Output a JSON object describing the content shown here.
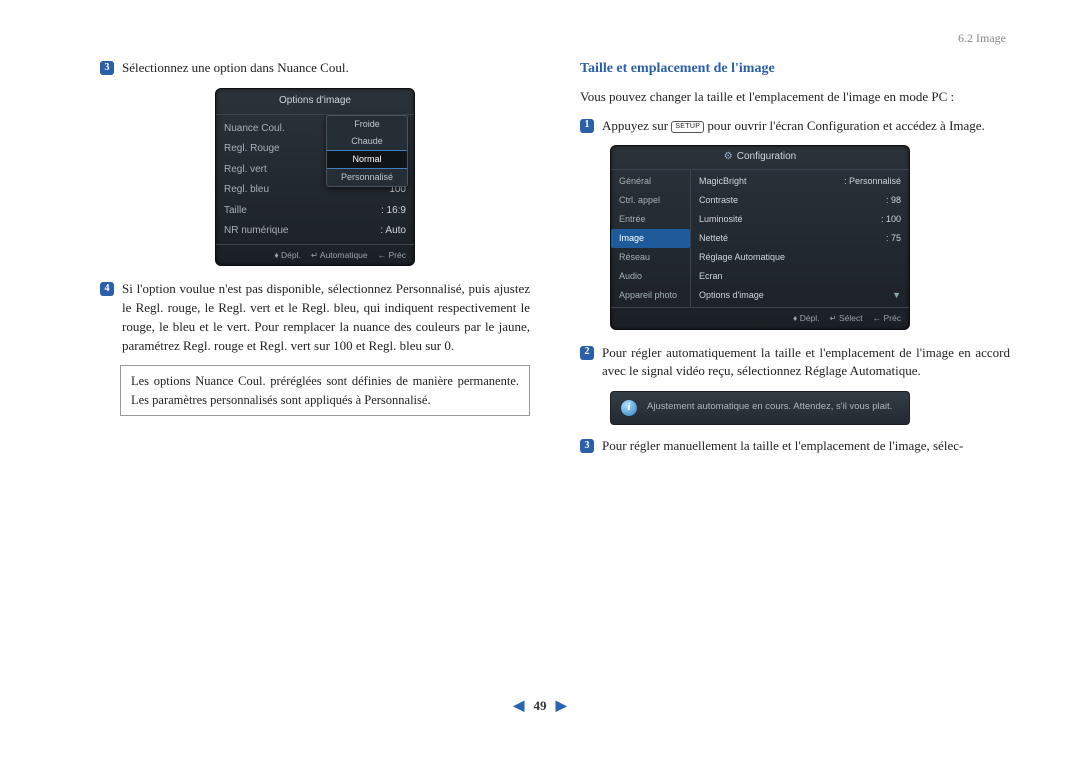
{
  "header": {
    "section": "6.2 Image"
  },
  "left": {
    "step3": {
      "num": "3",
      "text": "Sélectionnez une option dans Nuance Coul."
    },
    "osd1": {
      "title": "Options d'image",
      "rows": {
        "nuance": "Nuance Coul.",
        "regl_rouge": "Regl. Rouge",
        "regl_vert": "Regl. vert",
        "regl_bleu_label": "Regl. bleu",
        "regl_bleu_val": "100",
        "taille_label": "Taille",
        "taille_val": ": 16:9",
        "nr_label": "NR numérique",
        "nr_val": ": Auto"
      },
      "dropdown": {
        "opt1": "Froide",
        "opt2": "Chaude",
        "opt3": "Normal",
        "opt4": "Personnalisé"
      },
      "footer": {
        "move": "Dépl.",
        "auto": "Automatique",
        "back": "Préc"
      }
    },
    "step4": {
      "num": "4",
      "text": "Si l'option voulue n'est pas disponible, sélectionnez Personnalisé, puis ajustez le Regl. rouge, le Regl. vert et le Regl. bleu, qui indiquent respectivement le rouge, le bleu et le vert. Pour remplacer la nuance des couleurs par le jaune, paramétrez Regl. rouge et Regl. vert sur 100 et Regl. bleu sur 0."
    },
    "note": "Les options Nuance Coul. préréglées sont définies de manière permanente. Les paramètres personnalisés sont appliqués à Personnalisé."
  },
  "right": {
    "title": "Taille et emplacement de l'image",
    "intro": "Vous pouvez changer la taille et l'emplacement de l'image en mode PC :",
    "step1": {
      "num": "1",
      "pre": "Appuyez sur ",
      "key": "SETUP",
      "post": " pour ouvrir l'écran Configuration et accédez à Image."
    },
    "osd2": {
      "title": "Configuration",
      "sidebar": {
        "general": "Général",
        "ctrl": "Ctrl. appel",
        "entree": "Entrée",
        "image": "Image",
        "reseau": "Réseau",
        "audio": "Audio",
        "appareil": "Appareil photo"
      },
      "main": {
        "magicbright_l": "MagicBright",
        "magicbright_v": ": Personnalisé",
        "contraste_l": "Contraste",
        "contraste_v": ": 98",
        "lum_l": "Luminosité",
        "lum_v": ": 100",
        "nettete_l": "Netteté",
        "nettete_v": ": 75",
        "reglage_auto": "Réglage Automatique",
        "ecran": "Ecran",
        "options": "Options d'image"
      },
      "footer": {
        "move": "Dépl.",
        "select": "Sélect",
        "back": "Préc"
      }
    },
    "step2": {
      "num": "2",
      "text": "Pour régler automatiquement la taille et l'emplacement de l'image en accord avec le signal vidéo reçu, sélectionnez Réglage Automatique."
    },
    "infobox": "Ajustement automatique en cours. Attendez, s'il vous plait.",
    "step3r": {
      "num": "3",
      "text": "Pour régler manuellement la taille et l'emplacement de l'image, sélec-"
    }
  },
  "pager": {
    "page": "49"
  }
}
